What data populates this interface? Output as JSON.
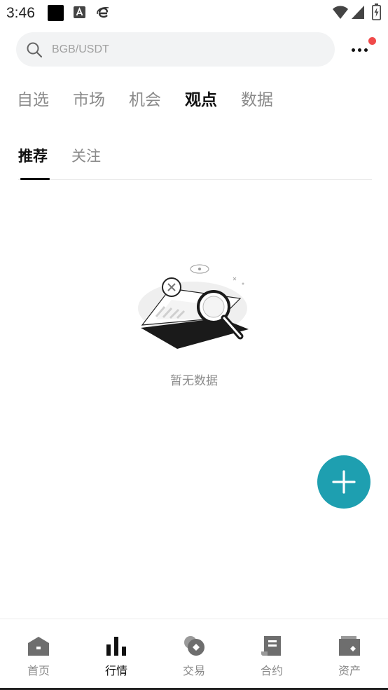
{
  "status_bar": {
    "time": "3:46",
    "icons": [
      "black-square-icon",
      "a-icon",
      "e-icon",
      "wifi-icon",
      "signal-icon",
      "battery-icon"
    ]
  },
  "search": {
    "placeholder": "BGB/USDT",
    "icon": "search-icon"
  },
  "more_menu": {
    "icon": "more-icon",
    "has_notification": true,
    "notification_color": "#f04a4a"
  },
  "main_tabs": [
    {
      "label": "自选",
      "active": false
    },
    {
      "label": "市场",
      "active": false
    },
    {
      "label": "机会",
      "active": false
    },
    {
      "label": "观点",
      "active": true
    },
    {
      "label": "数据",
      "active": false
    }
  ],
  "sub_tabs": [
    {
      "label": "推荐",
      "active": true
    },
    {
      "label": "关注",
      "active": false
    }
  ],
  "empty_state": {
    "icon": "magnifier-illustration",
    "text": "暂无数据"
  },
  "fab": {
    "icon": "plus-icon",
    "color": "#1e9fb0"
  },
  "bottom_nav": [
    {
      "label": "首页",
      "icon": "home-icon",
      "active": false
    },
    {
      "label": "行情",
      "icon": "bar-chart-icon",
      "active": true
    },
    {
      "label": "交易",
      "icon": "trade-icon",
      "active": false
    },
    {
      "label": "合约",
      "icon": "contract-icon",
      "active": false
    },
    {
      "label": "资产",
      "icon": "wallet-icon",
      "active": false
    }
  ],
  "colors": {
    "accent": "#1e9fb0",
    "text_primary": "#111111",
    "text_secondary": "#8a8a8a",
    "search_bg": "#f2f3f4"
  }
}
